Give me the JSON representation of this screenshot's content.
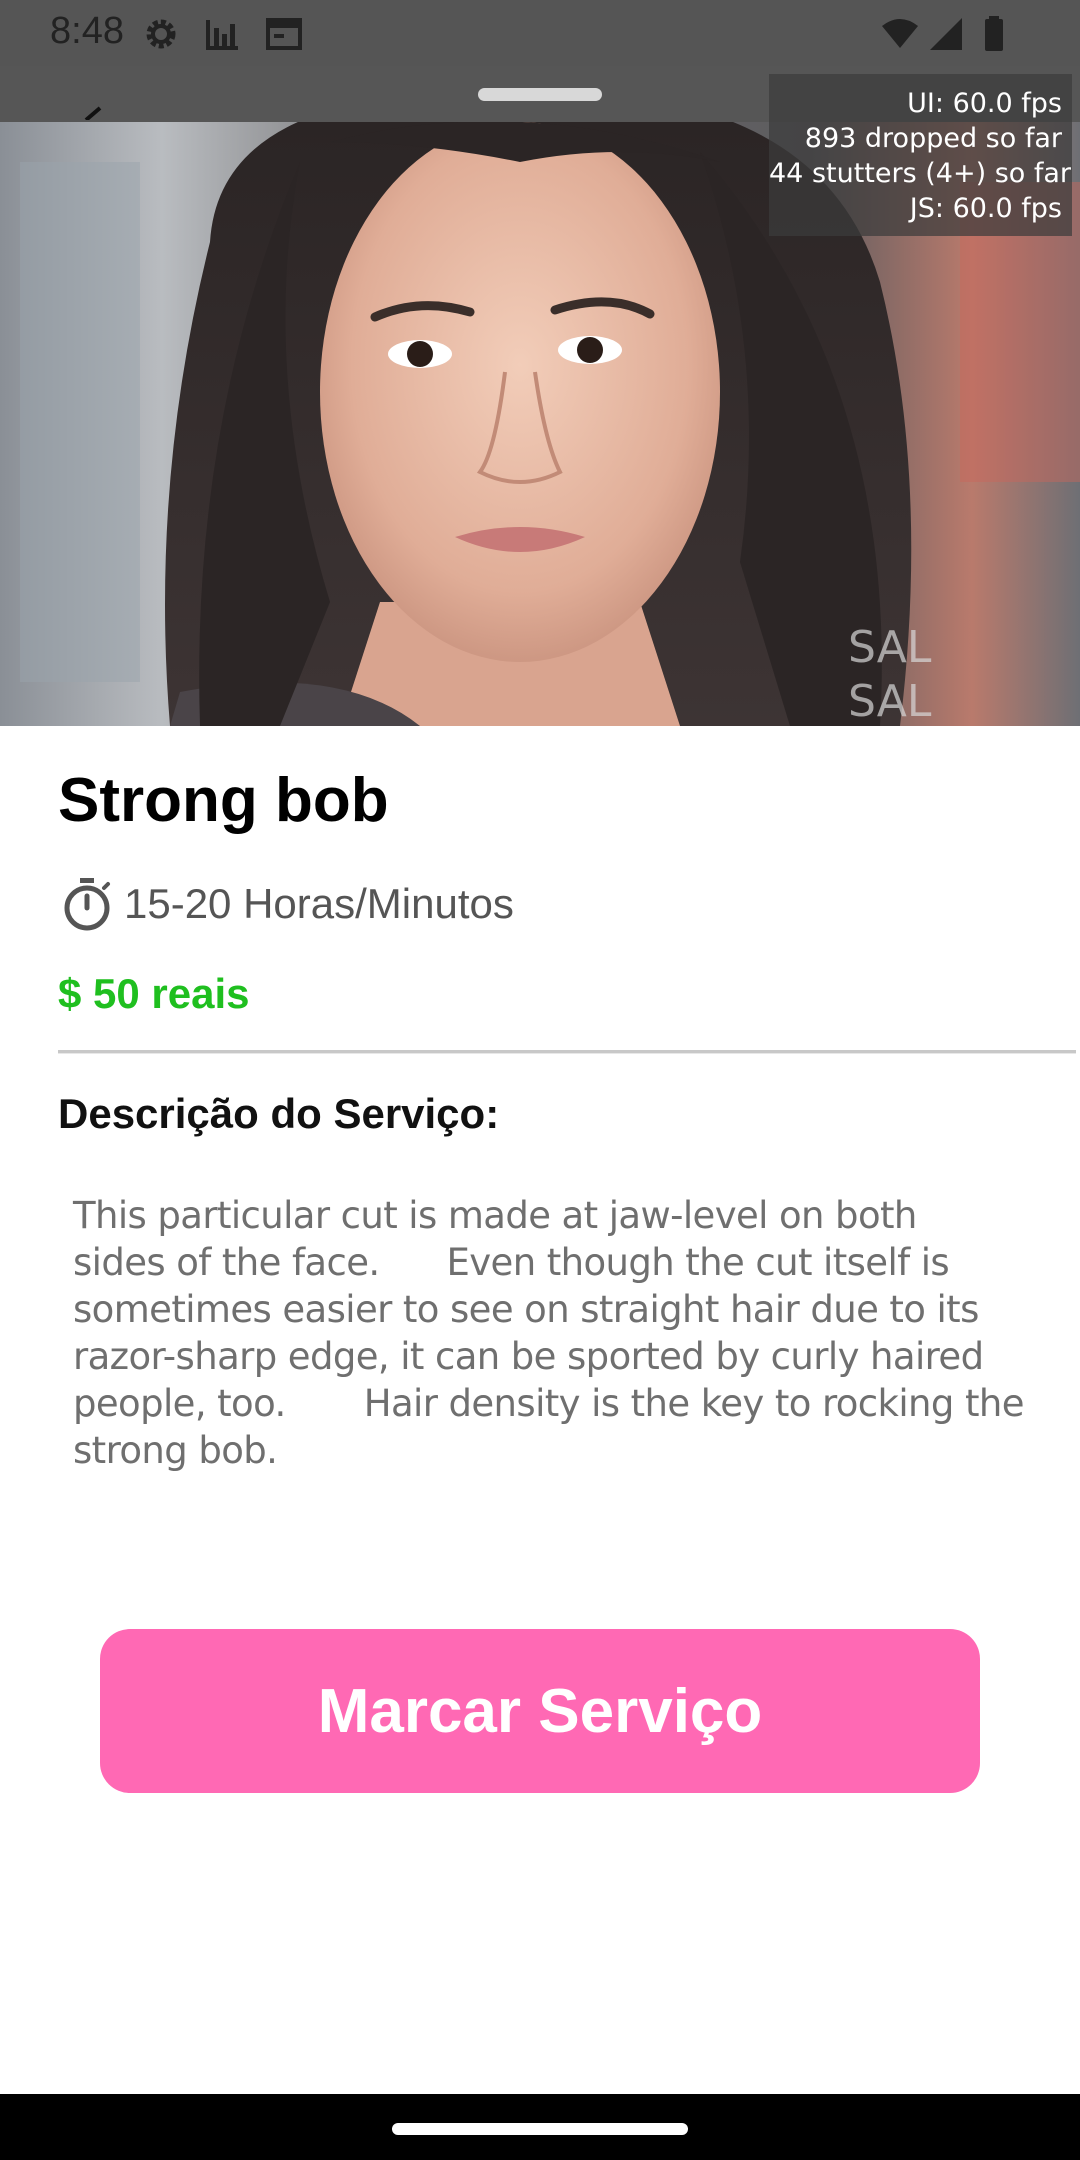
{
  "status_bar": {
    "time": "8:48",
    "icons": [
      "settings-gear-icon",
      "bar-chart-icon",
      "calendar-icon",
      "wifi-icon",
      "cell-signal-icon",
      "battery-icon"
    ]
  },
  "perf_overlay": {
    "ui_fps": "UI: 60.0 fps",
    "dropped": "893 dropped so far",
    "stutters": "44 stutters (4+) so far",
    "js_fps": "JS: 60.0 fps"
  },
  "hero": {
    "image_watermark": "SAL"
  },
  "service": {
    "title": "Strong bob",
    "duration": "15-20 Horas/Minutos",
    "price": "$ 50 reais",
    "price_color": "#1fbf1f",
    "description_heading": "Descrição do Serviço:",
    "description": "This particular cut is made at jaw-level on both\nsides of the face.      Even though the cut itself is\nsometimes easier to see on straight hair due to its\nrazor-sharp edge, it can be sported by curly haired\npeople, too.       Hair density is the key to rocking the\nstrong bob."
  },
  "actions": {
    "book_label": "Marcar Serviço",
    "book_color": "#ff69b4"
  }
}
